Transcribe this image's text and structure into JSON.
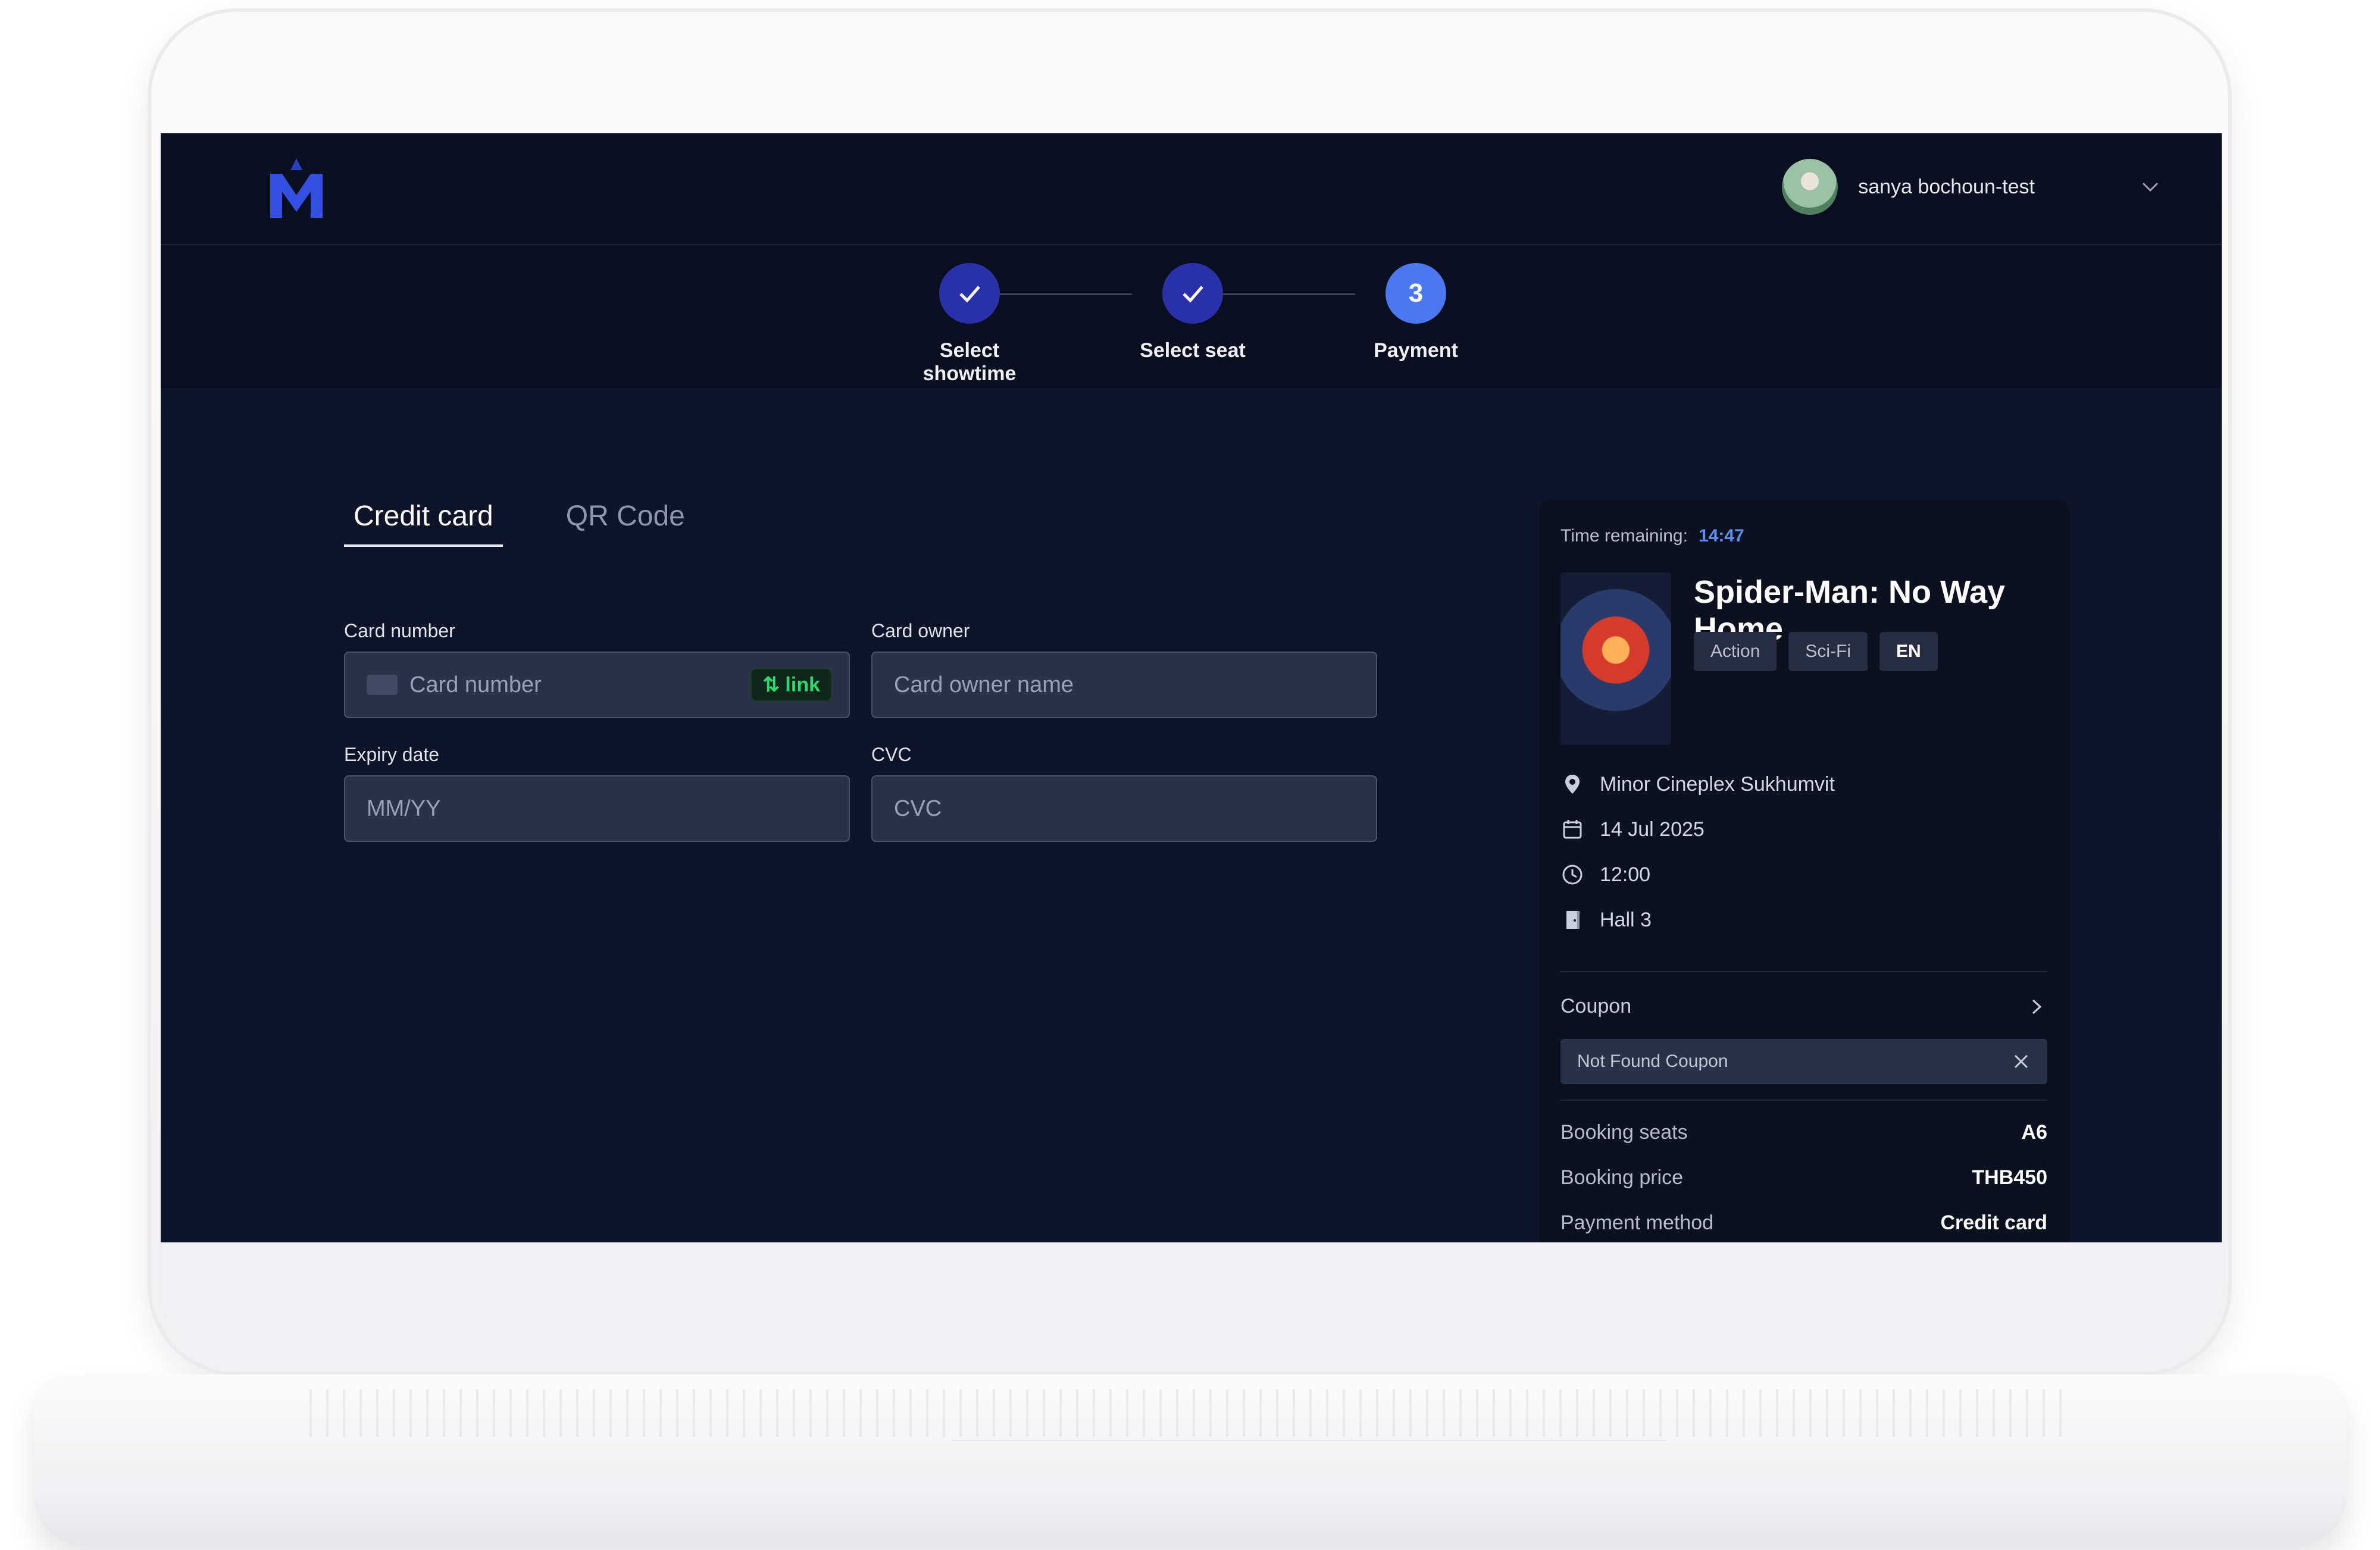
{
  "header": {
    "logo_letter": "M",
    "user_name": "sanya bochoun-test"
  },
  "steps": [
    {
      "label": "Select showtime",
      "state": "done",
      "number": ""
    },
    {
      "label": "Select seat",
      "state": "done",
      "number": ""
    },
    {
      "label": "Payment",
      "state": "active",
      "number": "3"
    }
  ],
  "payment_tabs": [
    {
      "label": "Credit card",
      "active": true
    },
    {
      "label": "QR Code",
      "active": false
    }
  ],
  "form": {
    "card_number": {
      "label": "Card number",
      "placeholder": "Card number",
      "badge": "link"
    },
    "card_owner": {
      "label": "Card owner",
      "placeholder": "Card owner name"
    },
    "expiry": {
      "label": "Expiry date",
      "placeholder": "MM/YY"
    },
    "cvc": {
      "label": "CVC",
      "placeholder": "CVC"
    }
  },
  "summary": {
    "time_label": "Time remaining:",
    "time_value": "14:47",
    "movie_title": "Spider-Man: No Way Home",
    "tags": [
      "Action",
      "Sci-Fi",
      "EN"
    ],
    "cinema": "Minor Cineplex Sukhumvit",
    "date": "14 Jul 2025",
    "time": "12:00",
    "hall": "Hall 3",
    "coupon_label": "Coupon",
    "coupon_value": "Not Found Coupon",
    "booking_seats_label": "Booking seats",
    "booking_seats_value": "A6",
    "booking_price_label": "Booking price",
    "booking_price_value": "THB450",
    "payment_method_label": "Payment method",
    "payment_method_value": "Credit card"
  },
  "colors": {
    "accent": "#4b78f0",
    "step_done": "#2a31a8",
    "timer": "#5d8cf5",
    "link_badge": "#2fd86c"
  }
}
